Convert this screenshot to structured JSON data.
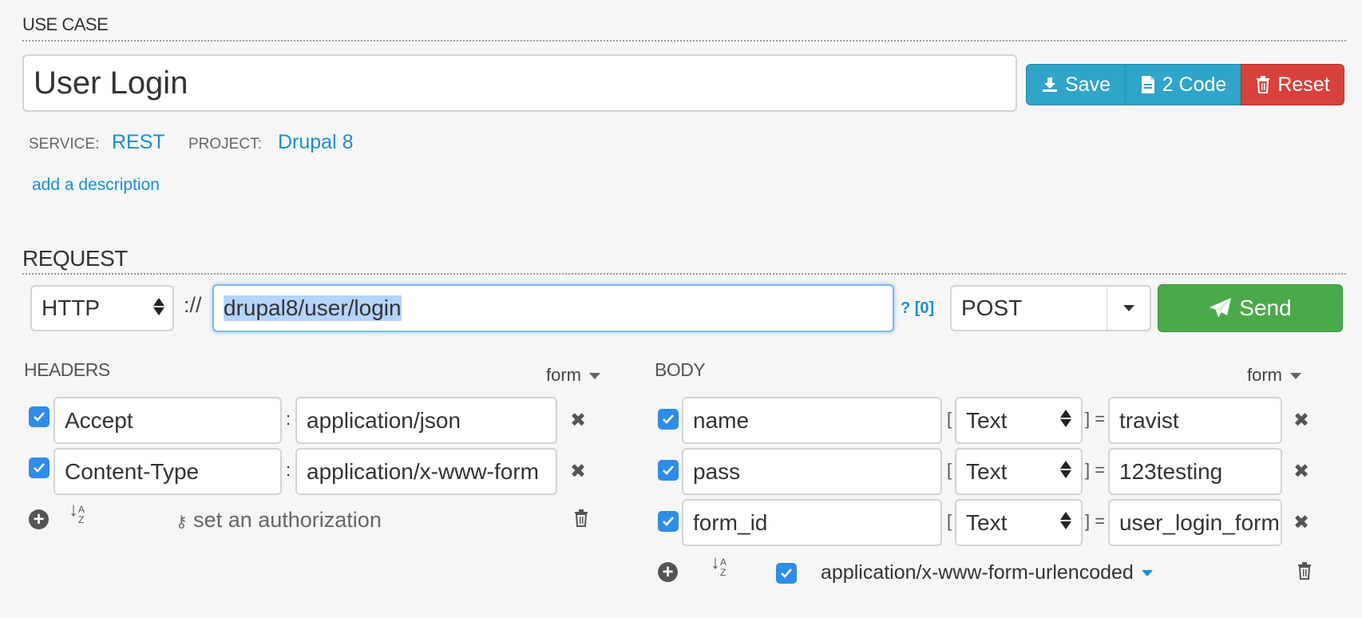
{
  "use_case": {
    "section_title": "USE CASE",
    "name_value": "User Login",
    "buttons": {
      "save": "Save",
      "code": "2 Code",
      "reset": "Reset"
    },
    "service_label": "SERVICE:",
    "service_value": "REST",
    "project_label": "PROJECT:",
    "project_value": "Drupal 8",
    "add_description": "add a description"
  },
  "request": {
    "section_title": "REQUEST",
    "protocol": "HTTP",
    "separator": "://",
    "url": "drupal8/user/login",
    "query_hint": "? [0]",
    "method": "POST",
    "send_label": "Send"
  },
  "headers": {
    "title": "HEADERS",
    "mode": "form",
    "rows": [
      {
        "key": "Accept",
        "value": "application/json"
      },
      {
        "key": "Content-Type",
        "value": "application/x-www-form"
      }
    ],
    "set_authorization": "set an authorization"
  },
  "body": {
    "title": "BODY",
    "mode": "form",
    "rows": [
      {
        "key": "name",
        "type": "Text",
        "value": "travist"
      },
      {
        "key": "pass",
        "type": "Text",
        "value": "123testing"
      },
      {
        "key": "form_id",
        "type": "Text",
        "value": "user_login_form"
      }
    ],
    "content_type": "application/x-www-form-urlencoded"
  },
  "colors": {
    "save": "#2ea5c9",
    "code": "#2ea5c9",
    "reset": "#d9413d",
    "send": "#4aaa4a",
    "link": "#1a8fd1",
    "checkbox": "#2e8de6"
  }
}
